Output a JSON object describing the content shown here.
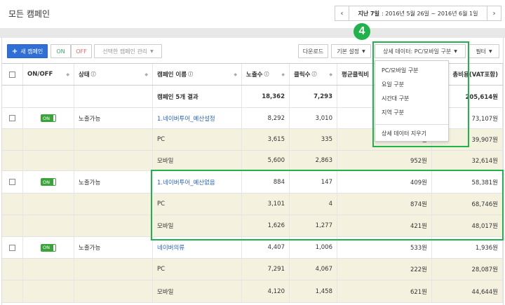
{
  "header": {
    "title": "모든 캠페인",
    "date_prev": "‹",
    "date_next": "›",
    "date_label": "지난 7일",
    "date_range": ": 2016년 5월 26일 ~ 2016년 6월 1일"
  },
  "toolbar": {
    "new_campaign": "새 캠페인",
    "on": "ON",
    "off": "OFF",
    "manage_selected": "선택한 캠페인 관리",
    "download": "다운로드",
    "basic_settings": "기본 설정",
    "detail_data": "상세 데이터: PC/모바일 구분",
    "filter": "필터"
  },
  "step_number": "4",
  "detail_menu": {
    "items": [
      "PC/모바일 구분",
      "요일 구분",
      "시간대 구분",
      "지역 구분"
    ],
    "clear": "상세 데이터 지우기"
  },
  "table": {
    "columns": [
      "ON/OFF",
      "상태",
      "캠페인 이름",
      "노출수",
      "클릭수",
      "평균클릭비",
      "총비용(VAT포함)"
    ],
    "summary": {
      "label": "캠페인 5개 결과",
      "impressions": "18,362",
      "clicks": "7,293",
      "total_cost": "205,614원"
    },
    "toggle_label": "ON",
    "rows": [
      {
        "status": "노출가능",
        "name": "1.네이버투어_예산설정",
        "impressions": "8,292",
        "clicks": "3,010",
        "avg_cpc": "",
        "cost": "73,107원",
        "subs": [
          {
            "label": "PC",
            "impressions": "3,615",
            "clicks": "335",
            "avg_cpc": "원",
            "cost": "39,907원"
          },
          {
            "label": "모바일",
            "impressions": "5,600",
            "clicks": "2,863",
            "avg_cpc": "952원",
            "cost": "32,614원"
          }
        ]
      },
      {
        "status": "노출가능",
        "name": "1.네이버투어_예산없음",
        "impressions": "884",
        "clicks": "147",
        "avg_cpc": "409원",
        "cost": "58,381원",
        "subs": [
          {
            "label": "PC",
            "impressions": "3,101",
            "clicks": "4",
            "avg_cpc": "874원",
            "cost": "68,746원"
          },
          {
            "label": "모바일",
            "impressions": "1,626",
            "clicks": "1,277",
            "avg_cpc": "421원",
            "cost": "48,017원"
          }
        ]
      },
      {
        "status": "노출가능",
        "name": "네이버의류",
        "impressions": "4,407",
        "clicks": "1,006",
        "avg_cpc": "533원",
        "cost": "1,936원",
        "subs": [
          {
            "label": "PC",
            "impressions": "7,291",
            "clicks": "4,067",
            "avg_cpc": "222원",
            "cost": "28,087원"
          },
          {
            "label": "모바일",
            "impressions": "4,120",
            "clicks": "1,458",
            "avg_cpc": "621원",
            "cost": "44,644원"
          }
        ]
      }
    ]
  },
  "colors": {
    "primary": "#2f6fd6",
    "highlight": "#22b24c",
    "sub_row": "#f4f2df",
    "toggle_on": "#3aa33a",
    "link": "#2a63c2"
  }
}
